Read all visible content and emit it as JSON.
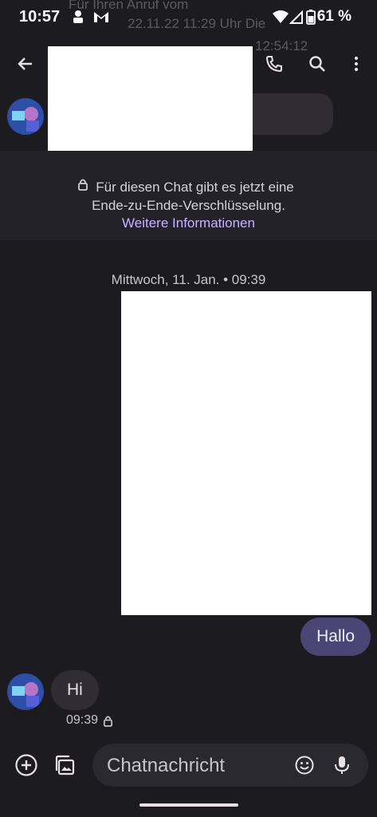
{
  "status_bar": {
    "time": "10:57",
    "battery": "61 %"
  },
  "header_ghost": {
    "line1": "Für Ihren Anruf vom",
    "line2": "22.11.22 11:29 Uhr Die",
    "line3": "12:54:12"
  },
  "encryption_banner": {
    "line1": "Für diesen Chat gibt es jetzt eine",
    "line2": "Ende-zu-Ende-Verschlüsselung.",
    "link": "Weitere Informationen"
  },
  "date_separator": "Mittwoch, 11. Jan. • 09:39",
  "messages": {
    "outgoing": "Hallo",
    "incoming": "Hi",
    "incoming_time": "09:39"
  },
  "composer": {
    "placeholder": "Chatnachricht"
  },
  "colors": {
    "background": "#1c1b1f",
    "outgoing_bubble": "#4a4575",
    "link": "#c6b5ff"
  }
}
